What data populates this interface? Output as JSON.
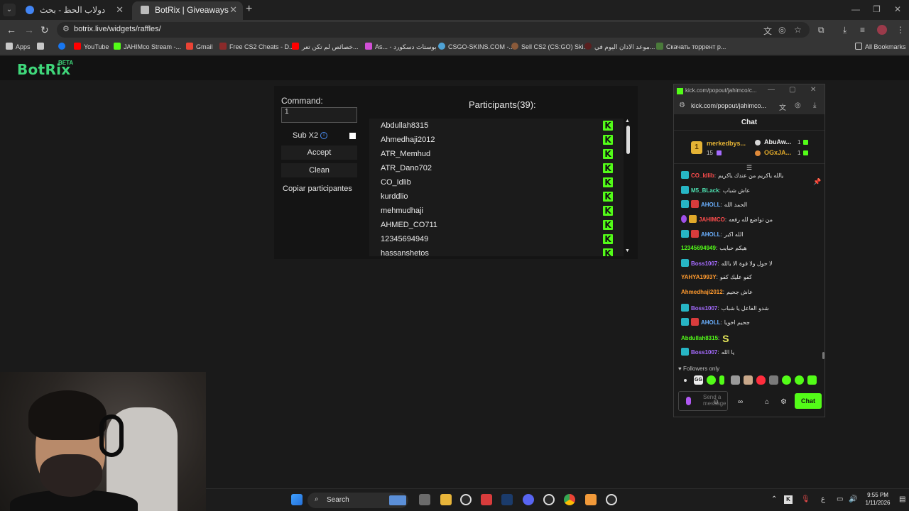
{
  "browser": {
    "tabs": [
      {
        "title": "دولاب الحظ - بحث Google",
        "active": false
      },
      {
        "title": "BotRix | Giveaways",
        "active": true
      }
    ],
    "url": "botrix.live/widgets/raffles/",
    "bookmarks": [
      {
        "label": "Apps",
        "icon": "grid-icon",
        "color": "#c8c8c8"
      },
      {
        "label": "",
        "icon": "apps-grid-icon",
        "color": "#c8c8c8"
      },
      {
        "label": "",
        "icon": "facebook-icon",
        "color": "#1877f2"
      },
      {
        "label": "YouTube",
        "icon": "youtube-icon",
        "color": "#ff0000"
      },
      {
        "label": "JAHIMco Stream -...",
        "icon": "kick-icon",
        "color": "#53fc18"
      },
      {
        "label": "Gmail",
        "icon": "gmail-icon",
        "color": "#ea4335"
      },
      {
        "label": "Free CS2 Cheats - D...",
        "icon": "site-icon",
        "color": "#8b2a2a"
      },
      {
        "label": "خصائص لم تكن تعر...",
        "icon": "youtube-icon",
        "color": "#ff0000"
      },
      {
        "label": "As... - بوستات دسكورد",
        "icon": "site-icon",
        "color": "#d14fd6"
      },
      {
        "label": "CSGO-SKINS.COM -...",
        "icon": "site-icon",
        "color": "#4fa3d6"
      },
      {
        "label": "Sell CS2 (CS:GO) Ski...",
        "icon": "site-icon",
        "color": "#8a5a3a"
      },
      {
        "label": "موعد الاذان اليوم في...",
        "icon": "site-icon",
        "color": "#5a1f1f"
      },
      {
        "label": "Скачать торрент р...",
        "icon": "site-icon",
        "color": "#4a7a3a"
      }
    ],
    "all_bookmarks": "All Bookmarks"
  },
  "botrix": {
    "logo": "BotRix",
    "beta": "BETA",
    "command_label": "Command:",
    "command_value": "1",
    "sub_label": "Sub X2",
    "sub_checked": false,
    "accept": "Accept",
    "clean": "Clean",
    "copy": "Copiar participantes",
    "participants_title": "Participants(39):",
    "participants": [
      "Abdullah8315",
      "Ahmedhaji2012",
      "ATR_Memhud",
      "ATR_Dano702",
      "CO_Idlib",
      "kurddlio",
      "mehmudhaji",
      "AHMED_CO711",
      "12345694949",
      "hassanshetos"
    ]
  },
  "kick": {
    "window_title": "kick.com/popout/jahimco/c...",
    "url": "kick.com/popout/jahimco...",
    "chat_title": "Chat",
    "leaderboard": {
      "rank": "1",
      "first_name": "merkedbys...",
      "first_count": "15",
      "second_name": "AbuAw...",
      "second_count": "1",
      "third_name": "OGxJA...",
      "third_count": "1"
    },
    "messages": [
      {
        "badge": "cyan",
        "user": "CO_Idlib",
        "color": "#ff4d4d",
        "text": "يالله ياكريم من عندك ياكريم"
      },
      {
        "badge": "cyan",
        "user": "M5_BLack",
        "color": "#4de0b0",
        "text": "عاش شباب"
      },
      {
        "badge": "cyan2",
        "user": "AHOLL",
        "color": "#6ab0ff",
        "text": "الحمد الله"
      },
      {
        "badge": "mic",
        "user": "JAHIMCO",
        "color": "#ff4d4d",
        "text": "من تواضع لله رفعه"
      },
      {
        "badge": "cyan2",
        "user": "AHOLL",
        "color": "#6ab0ff",
        "text": "الله اكبر"
      },
      {
        "badge": "",
        "user": "12345694949",
        "color": "#53fc18",
        "text": "هيكم حبايب"
      },
      {
        "badge": "cyan",
        "user": "Boss1007",
        "color": "#a56bff",
        "text": "لا حول ولا قوة الا بالله"
      },
      {
        "badge": "",
        "user": "YAHYA1993Y",
        "color": "#ff9a2e",
        "text": "كفو عليك كفو"
      },
      {
        "badge": "",
        "user": "Ahmedhaji2012",
        "color": "#ff9a2e",
        "text": "عاش جحيم"
      },
      {
        "badge": "cyan",
        "user": "Boss1007",
        "color": "#a56bff",
        "text": "شدو الفاعل يا شباب"
      },
      {
        "badge": "cyan2",
        "user": "AHOLL",
        "color": "#6ab0ff",
        "text": "جحيم اخويا"
      },
      {
        "badge": "",
        "user": "Abdullah8315",
        "color": "#53fc18",
        "text": "",
        "emote": "S"
      },
      {
        "badge": "cyan",
        "user": "Boss1007",
        "color": "#a56bff",
        "text": "يا الله"
      }
    ],
    "followers_only": "Followers only",
    "send_placeholder": "Send a message",
    "chat_button": "Chat"
  },
  "taskbar": {
    "search": "Search",
    "time": "9:55 PM",
    "date": "1/11/2026",
    "lang": "ع"
  },
  "colors": {
    "kick_green": "#53fc18",
    "botrix_green": "#3fd67a"
  }
}
